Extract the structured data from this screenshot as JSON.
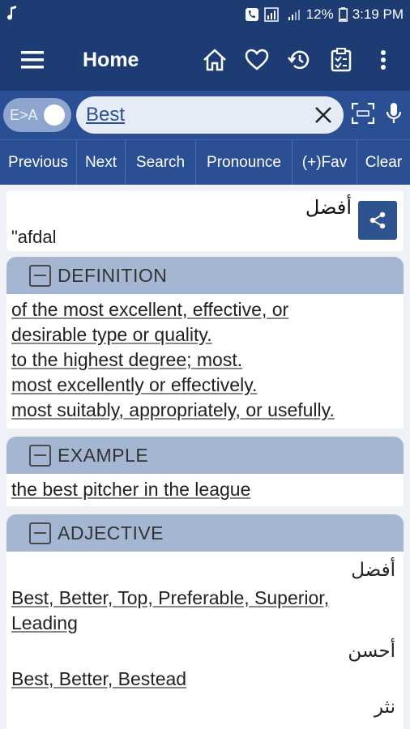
{
  "status": {
    "left_icon": "music-note-icon",
    "battery": "12%",
    "time": "3:19 PM"
  },
  "appbar": {
    "title": "Home",
    "icons": [
      "menu-icon",
      "home-icon",
      "heart-icon",
      "history-icon",
      "clipboard-icon",
      "more-vert-icon"
    ]
  },
  "search": {
    "toggle_label": "E>A",
    "value": "Best"
  },
  "buttons": [
    "Previous",
    "Next",
    "Search",
    "Pronounce",
    "(+)Fav",
    "Clear"
  ],
  "word": {
    "arabic": "أفضل",
    "transliteration": "\"afdal"
  },
  "definition": {
    "header": "DEFINITION",
    "lines": [
      "of the most excellent, effective, or",
      "desirable type or quality.",
      "to the highest degree; most.",
      "most excellently or effectively.",
      "most suitably, appropriately, or usefully."
    ]
  },
  "example": {
    "header": "EXAMPLE",
    "lines": [
      "the best pitcher in the league"
    ]
  },
  "adjective": {
    "header": "ADJECTIVE",
    "groups": [
      {
        "arabic": "أفضل",
        "synonyms": [
          "Best, Better, Top, Preferable, Superior,",
          "Leading"
        ]
      },
      {
        "arabic": "أحسن",
        "synonyms": [
          "Best, Better, Bestead"
        ]
      },
      {
        "arabic": "نثر",
        "synonyms": []
      }
    ]
  },
  "colors": {
    "appbar": "#1e3c74",
    "toolbar": "#2a4f94",
    "section_header": "#a4b6d2",
    "share_button": "#2d548f"
  }
}
